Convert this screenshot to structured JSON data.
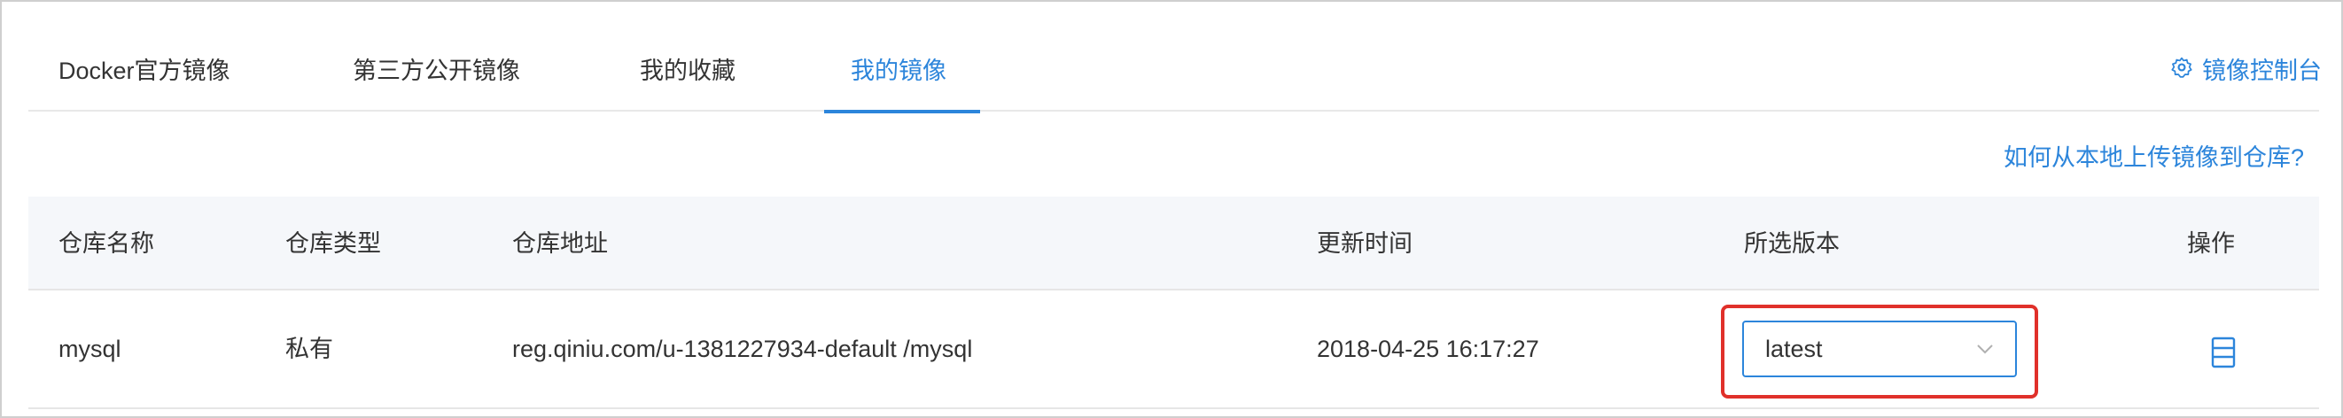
{
  "tabs": [
    {
      "label": "Docker官方镜像",
      "active": false
    },
    {
      "label": "第三方公开镜像",
      "active": false
    },
    {
      "label": "我的收藏",
      "active": false
    },
    {
      "label": "我的镜像",
      "active": true
    }
  ],
  "console_link": {
    "label": "镜像控制台",
    "icon": "gear-icon"
  },
  "help_link": "如何从本地上传镜像到仓库?",
  "table": {
    "headers": [
      "仓库名称",
      "仓库类型",
      "仓库地址",
      "更新时间",
      "所选版本",
      "操作"
    ],
    "rows": [
      {
        "name": "mysql",
        "type": "私有",
        "address": "reg.qiniu.com/u-1381227934-default /mysql",
        "updated": "2018-04-25 16:17:27",
        "version": "latest",
        "action_icon": "document-icon"
      }
    ]
  },
  "colors": {
    "accent": "#2c85db",
    "highlight": "#e0302a"
  }
}
